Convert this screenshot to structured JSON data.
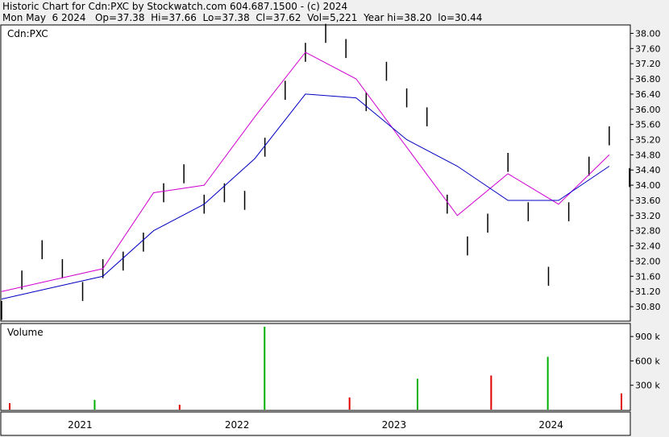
{
  "header": {
    "line1": "Historic Chart for Cdn:PXC by Stockwatch.com 604.687.1500 - (c) 2024",
    "line2": "Mon May  6 2024   Op=37.38  Hi=37.66  Lo=37.38  Cl=37.62  Vol=5,221  Year hi=38.20  lo=30.44"
  },
  "chart_data": {
    "type": "line",
    "price_panel": {
      "label": "Cdn:PXC",
      "ylim": [
        30.44,
        38.2
      ],
      "yticks": [
        "38.00",
        "37.60",
        "37.20",
        "36.80",
        "36.40",
        "36.00",
        "35.60",
        "35.20",
        "34.80",
        "34.40",
        "34.00",
        "33.60",
        "33.20",
        "32.80",
        "32.40",
        "32.00",
        "31.60",
        "31.20",
        "30.80"
      ],
      "series": [
        {
          "style": "ohlc-bars",
          "color": "#000000",
          "x": [
            0,
            4,
            8,
            12,
            16,
            20,
            24,
            28,
            32,
            36,
            40,
            44,
            48,
            52,
            56,
            60,
            64,
            68,
            72,
            76,
            80,
            84,
            88,
            92,
            96,
            100,
            104,
            108,
            112,
            116,
            120,
            124
          ],
          "values": [
            30.7,
            31.5,
            32.3,
            31.8,
            31.2,
            31.8,
            32.0,
            32.5,
            33.8,
            34.3,
            33.5,
            33.8,
            33.6,
            35.0,
            36.5,
            37.5,
            38.0,
            37.6,
            36.2,
            37.0,
            36.3,
            35.8,
            33.5,
            32.4,
            33.0,
            34.6,
            33.3,
            31.6,
            33.3,
            34.5,
            35.3,
            34.2
          ]
        },
        {
          "style": "line",
          "name": "",
          "color": "#d000d0",
          "x": [
            0,
            10,
            20,
            30,
            40,
            50,
            60,
            70,
            80,
            90,
            100,
            110,
            120
          ],
          "values": [
            31.2,
            31.5,
            31.8,
            33.8,
            34.0,
            35.8,
            37.5,
            36.8,
            35.0,
            33.2,
            34.3,
            33.5,
            34.8
          ]
        },
        {
          "style": "line",
          "name": "",
          "color": "#0000c0",
          "x": [
            0,
            10,
            20,
            30,
            40,
            50,
            60,
            70,
            80,
            90,
            100,
            110,
            120
          ],
          "values": [
            31.0,
            31.3,
            31.6,
            32.8,
            33.5,
            34.7,
            36.4,
            36.3,
            35.2,
            34.5,
            33.6,
            33.6,
            34.5
          ]
        }
      ]
    },
    "volume_panel": {
      "label": "Volume",
      "ylim": [
        0,
        1050
      ],
      "yticks": [
        "900 k",
        "600 k",
        "300 k"
      ],
      "ytick_values": [
        900,
        600,
        300
      ],
      "x": [
        10,
        25,
        40,
        55,
        70,
        82,
        95,
        105,
        118
      ],
      "values": [
        80,
        120,
        60,
        1020,
        150,
        380,
        420,
        650,
        200
      ]
    },
    "x_axis": {
      "labels": [
        "2021",
        "2022",
        "2023",
        "2024"
      ]
    }
  }
}
